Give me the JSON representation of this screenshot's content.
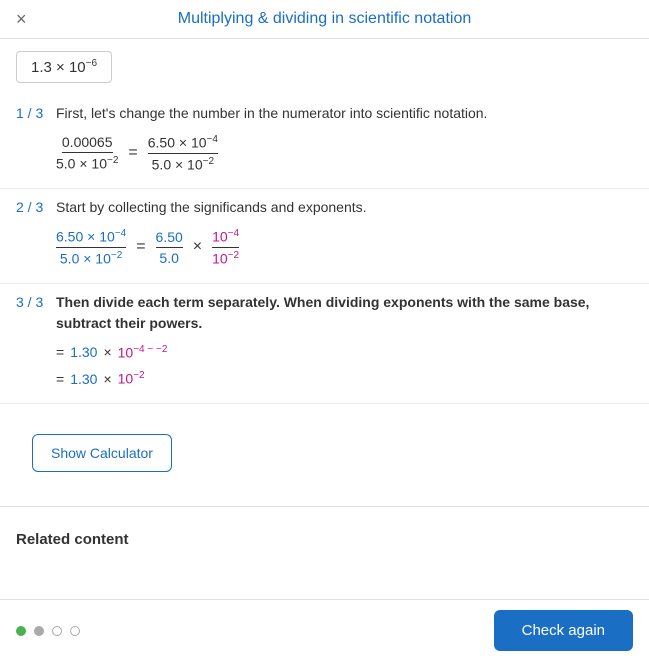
{
  "header": {
    "title": "Multiplying & dividing in scientific notation",
    "close_label": "×"
  },
  "answer": {
    "value": "1.3 × 10",
    "exponent": "−6"
  },
  "steps": [
    {
      "number": "1 / 3",
      "description": "First, let's change the number in the numerator into scientific notation.",
      "bold": false
    },
    {
      "number": "2 / 3",
      "description": "Start by collecting the significands and exponents.",
      "bold": false
    },
    {
      "number": "3 / 3",
      "description": "Then divide each term separately. When dividing exponents with the same base, subtract their powers.",
      "bold": true
    }
  ],
  "step3": {
    "line1_prefix": "= ",
    "line1_val": "1.30",
    "line1_times": "×",
    "line1_exp": "10",
    "line1_power": "−4 − −2",
    "line2_prefix": "= ",
    "line2_val": "1.30",
    "line2_times": "×",
    "line2_exp": "10",
    "line2_power": "−2"
  },
  "show_calculator_label": "Show Calculator",
  "related_content_label": "Related content",
  "dots": [
    {
      "type": "green"
    },
    {
      "type": "gray"
    },
    {
      "type": "empty"
    },
    {
      "type": "empty"
    }
  ],
  "check_again_label": "Check again"
}
